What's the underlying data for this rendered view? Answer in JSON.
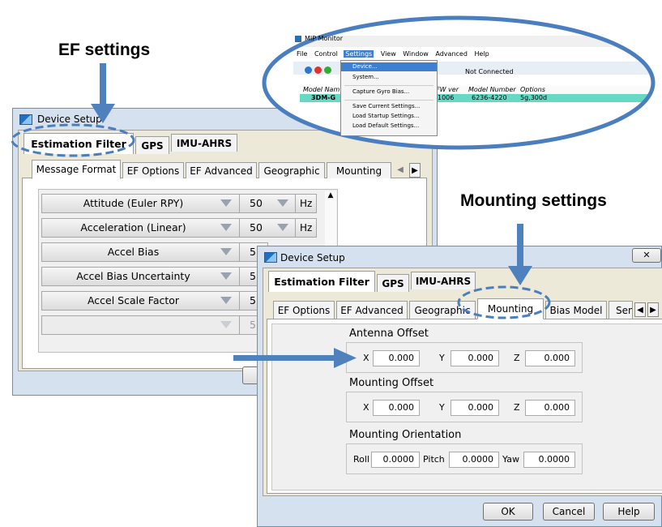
{
  "annotations": {
    "ef_settings": "EF settings",
    "mounting_settings": "Mounting settings"
  },
  "colors": {
    "highlight_blue": "#4a7ebf",
    "arrow_blue": "#4f81bd"
  },
  "mip_monitor": {
    "title": "MIP Monitor",
    "menu": [
      "File",
      "Control",
      "Settings",
      "View",
      "Window",
      "Advanced",
      "Help"
    ],
    "status": "Not Connected",
    "table_headers": [
      "Model Nam",
      "FW ver",
      "Model Number",
      "Options"
    ],
    "row": {
      "model": "3DM-G",
      "fw": "1006",
      "model_number": "6236-4220",
      "options": "5g,300d"
    },
    "settings_menu": [
      "Device...",
      "System...",
      "Capture Gyro Bias...",
      "Save Current Settings...",
      "Load Startup Settings...",
      "Load Default Settings..."
    ]
  },
  "dialog1": {
    "title": "Device Setup",
    "top_tabs": [
      "Estimation Filter",
      "GPS",
      "IMU-AHRS"
    ],
    "sub_tabs": [
      "Message Format",
      "EF Options",
      "EF Advanced",
      "Geographic",
      "Mounting"
    ],
    "rows": [
      {
        "name": "Attitude (Euler RPY)",
        "rate": "50",
        "unit": "Hz"
      },
      {
        "name": "Acceleration (Linear)",
        "rate": "50",
        "unit": "Hz"
      },
      {
        "name": "Accel Bias",
        "rate": "5"
      },
      {
        "name": "Accel Bias Uncertainty",
        "rate": "5"
      },
      {
        "name": "Accel Scale Factor",
        "rate": "5"
      },
      {
        "name": "",
        "rate": "5"
      }
    ]
  },
  "dialog2": {
    "title": "Device Setup",
    "close": "✕",
    "top_tabs": [
      "Estimation Filter",
      "GPS",
      "IMU-AHRS"
    ],
    "sub_tabs": [
      "EF Options",
      "EF Advanced",
      "Geographic",
      "Mounting",
      "Bias Model",
      "Sen"
    ],
    "antenna_offset": {
      "title": "Antenna Offset",
      "x_label": "X",
      "y_label": "Y",
      "z_label": "Z",
      "x": "0.000",
      "y": "0.000",
      "z": "0.000"
    },
    "mounting_offset": {
      "title": "Mounting Offset",
      "x_label": "X",
      "y_label": "Y",
      "z_label": "Z",
      "x": "0.000",
      "y": "0.000",
      "z": "0.000"
    },
    "mounting_orientation": {
      "title": "Mounting Orientation",
      "roll_label": "Roll",
      "pitch_label": "Pitch",
      "yaw_label": "Yaw",
      "roll": "0.0000",
      "pitch": "0.0000",
      "yaw": "0.0000"
    },
    "buttons": {
      "ok": "OK",
      "cancel": "Cancel",
      "help": "Help"
    }
  }
}
